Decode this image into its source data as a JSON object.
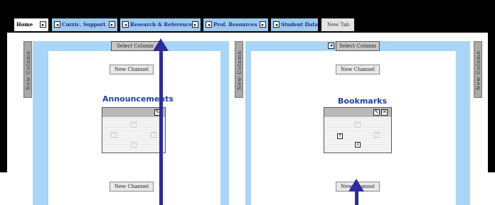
{
  "tabs": {
    "home": {
      "label": "Home",
      "arrow": "▸"
    },
    "curric": {
      "label": "Curric. Support",
      "arrow": "◂"
    },
    "research": {
      "label": "Research & Reference",
      "arrow": "◂"
    },
    "prof": {
      "label": "Prof. Resources",
      "arrow": "◂"
    },
    "student": {
      "label": "Student Data",
      "arrow": "◂"
    },
    "newtab": {
      "label": "New Tab"
    }
  },
  "sidebars": {
    "new_column_label": "New Column"
  },
  "left_column": {
    "select_column_label": "Select Column",
    "new_channel_top_label": "New Channel",
    "channel_title": "Announcements",
    "new_channel_bottom_label": "New Channel"
  },
  "right_column": {
    "select_column_label": "Select Column",
    "new_channel_top_label": "New Channel",
    "channel_title": "Bookmarks",
    "new_channel_bottom_label": "New Channel"
  },
  "icons": {
    "edit": "✎",
    "close": "✕",
    "plus": "+",
    "arrow_up": "↑",
    "arrow_down": "↓",
    "tab_right": "▸",
    "tab_left": "◂"
  },
  "colors": {
    "column_blue": "#a9d5f7",
    "tab_blue": "#9cc9ee",
    "annotation_arrow": "#2e2aa0",
    "title_blue": "#1d3fa8"
  }
}
